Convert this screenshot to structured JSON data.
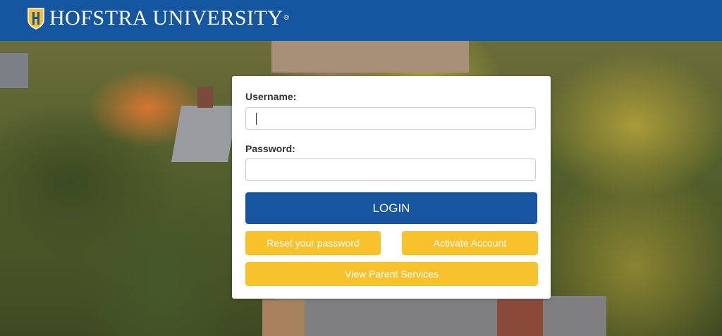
{
  "header": {
    "brand_name": "HOFSTRA UNIVERSITY",
    "brand_mark": "®",
    "background_color": "#1556a0",
    "logo_icon": "hofstra-shield-icon"
  },
  "login_form": {
    "username_label": "Username:",
    "username_value": "",
    "password_label": "Password:",
    "password_value": "",
    "login_button": "LOGIN",
    "reset_password_button": "Reset your password",
    "activate_account_button": "Activate Account",
    "parent_services_button": "View Parent Services",
    "primary_color": "#1656a0",
    "secondary_color": "#f8c22c"
  }
}
